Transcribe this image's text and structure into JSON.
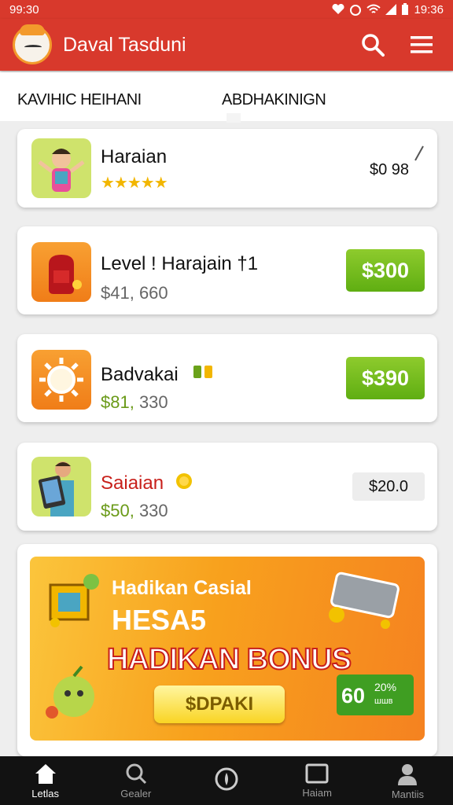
{
  "status_bar": {
    "time": "99:30",
    "right_time": "19:36"
  },
  "app_bar": {
    "title": "Daval Tasduni",
    "icons": [
      "app-logo-icon",
      "search-icon",
      "menu-icon"
    ]
  },
  "tabs": [
    "KAVIHIC HEIHANI",
    "ABDHAKINIGN"
  ],
  "items": [
    {
      "name": "Haraian",
      "rating": 5,
      "price": "$0 98",
      "thumbnail": "character-thumbnail"
    },
    {
      "name": "Level ! Harajain   †1",
      "sub_prefix": "$41,",
      "sub_suffix": " 660",
      "price": "$300",
      "thumbnail": "backpack-thumbnail"
    },
    {
      "name": "Badvakai",
      "sub_prefix": "$81,",
      "sub_suffix": " 330",
      "price": "$390",
      "thumbnail": "sun-thumbnail"
    },
    {
      "name": "Saiaian",
      "sub_prefix": "$50,",
      "sub_suffix": " 330",
      "price": "$20.0",
      "thumbnail": "tablet-character-thumbnail"
    }
  ],
  "promo": {
    "subtitle": "Hadikan Casial",
    "headline": "HESA5",
    "bonus": "HADIKAN BONUS",
    "cta": "$DPAKI",
    "offer_value": "60",
    "offer_percent": "20%",
    "offer_label": "шшв"
  },
  "bottom_nav": [
    {
      "label": "Letlas",
      "icon": "home-icon",
      "active": true
    },
    {
      "label": "Gealer",
      "icon": "search-icon",
      "active": false
    },
    {
      "label": "",
      "icon": "shield-icon",
      "active": false
    },
    {
      "label": "Haiam",
      "icon": "window-icon",
      "active": false
    },
    {
      "label": "Mantiis",
      "icon": "profile-icon",
      "active": false
    }
  ],
  "colors": {
    "primary": "#d8392c",
    "green": "#6bb81a",
    "orange": "#f58220",
    "yellow": "#f9d423"
  }
}
